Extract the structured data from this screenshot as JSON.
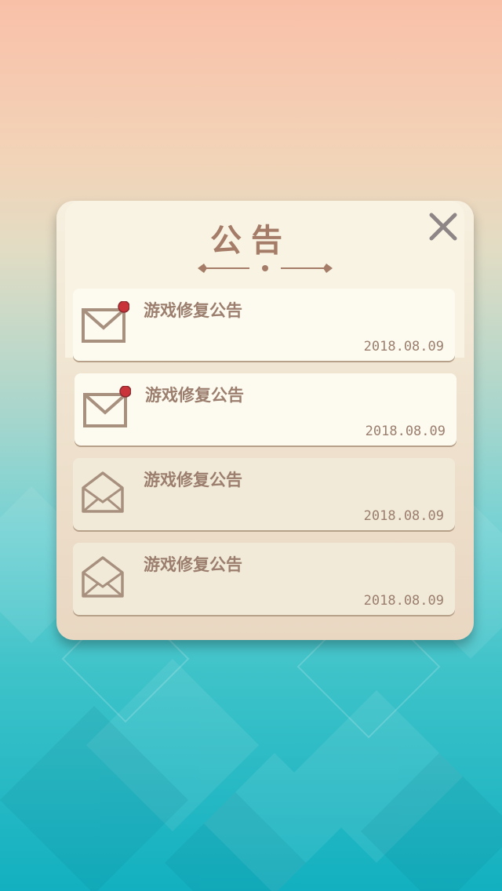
{
  "dialog": {
    "title": "公告",
    "close_icon": "close-icon",
    "ornament_icon": "divider-ornament-icon"
  },
  "notices": [
    {
      "title": "游戏修复公告",
      "date": "2018.08.09",
      "status": "unread",
      "icon": "envelope-closed-icon"
    },
    {
      "title": "游戏修复公告",
      "date": "2018.08.09",
      "status": "unread",
      "icon": "envelope-closed-icon"
    },
    {
      "title": "游戏修复公告",
      "date": "2018.08.09",
      "status": "read",
      "icon": "envelope-open-icon"
    },
    {
      "title": "游戏修复公告",
      "date": "2018.08.09",
      "status": "read",
      "icon": "envelope-open-icon"
    }
  ],
  "colors": {
    "text_brown": "#9b7e6d",
    "unread_dot": "#c8343a",
    "panel_bg": "#f7f0e0"
  }
}
